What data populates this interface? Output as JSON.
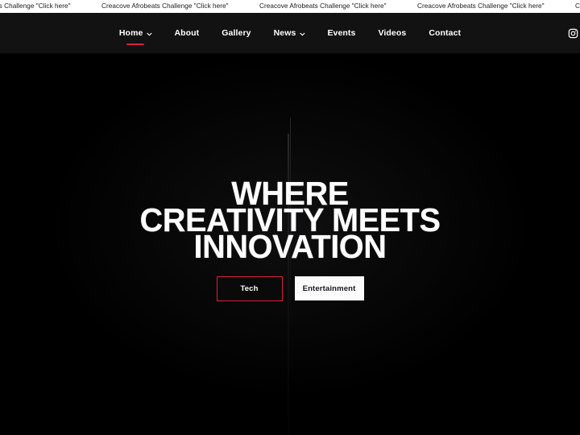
{
  "ticker": {
    "message": "Creacove Afrobeats Challenge \"Click here\"",
    "repeat_count": 6
  },
  "nav": {
    "items": [
      {
        "label": "Home",
        "has_dropdown": true,
        "active": true
      },
      {
        "label": "About",
        "has_dropdown": false,
        "active": false
      },
      {
        "label": "Gallery",
        "has_dropdown": false,
        "active": false
      },
      {
        "label": "News",
        "has_dropdown": true,
        "active": false
      },
      {
        "label": "Events",
        "has_dropdown": false,
        "active": false
      },
      {
        "label": "Videos",
        "has_dropdown": false,
        "active": false
      },
      {
        "label": "Contact",
        "has_dropdown": false,
        "active": false
      }
    ],
    "social": {
      "icon": "instagram-icon"
    },
    "accent_color": "#d81e3f",
    "background_color": "#121212"
  },
  "hero": {
    "title_lines": [
      "WHERE",
      "CREATIVITY MEETS",
      "INNOVATION"
    ],
    "background_color": "#000000",
    "buttons": [
      {
        "label": "Tech",
        "style": "outline",
        "border_color": "#d81e3f",
        "text_color": "#ffffff"
      },
      {
        "label": "Entertainment",
        "style": "solid",
        "background_color": "#fbfbfb",
        "text_color": "#16181d"
      }
    ]
  }
}
